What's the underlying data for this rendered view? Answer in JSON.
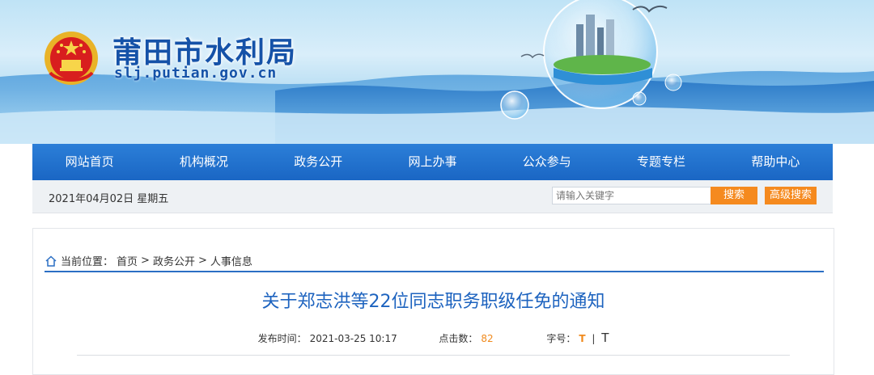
{
  "header": {
    "title": "莆田市水利局",
    "domain": "slj.putian.gov.cn"
  },
  "nav": {
    "items": [
      "网站首页",
      "机构概况",
      "政务公开",
      "网上办事",
      "公众参与",
      "专题专栏",
      "帮助中心"
    ]
  },
  "toolbar": {
    "date": "2021年04月02日  星期五",
    "search_placeholder": "请输入关键字",
    "search_label": "搜索",
    "advanced_search_label": "高级搜索"
  },
  "breadcrumb": {
    "prefix": "当前位置：",
    "items": [
      "首页",
      "政务公开",
      "人事信息"
    ],
    "separator": ">"
  },
  "article": {
    "title": "关于郑志洪等22位同志职务职级任免的通知",
    "publish_label": "发布时间：",
    "publish_time": "2021-03-25 10:17",
    "views_label": "点击数：",
    "views": "82",
    "font_size_label": "字号：",
    "font_small": "T",
    "font_divider": "|",
    "font_large": "T"
  },
  "icons": {
    "home": "home-icon",
    "emblem": "national-emblem-icon"
  },
  "colors": {
    "nav_blue": "#1a66c4",
    "title_blue": "#1d63bf",
    "accent_orange": "#f58a1f"
  }
}
